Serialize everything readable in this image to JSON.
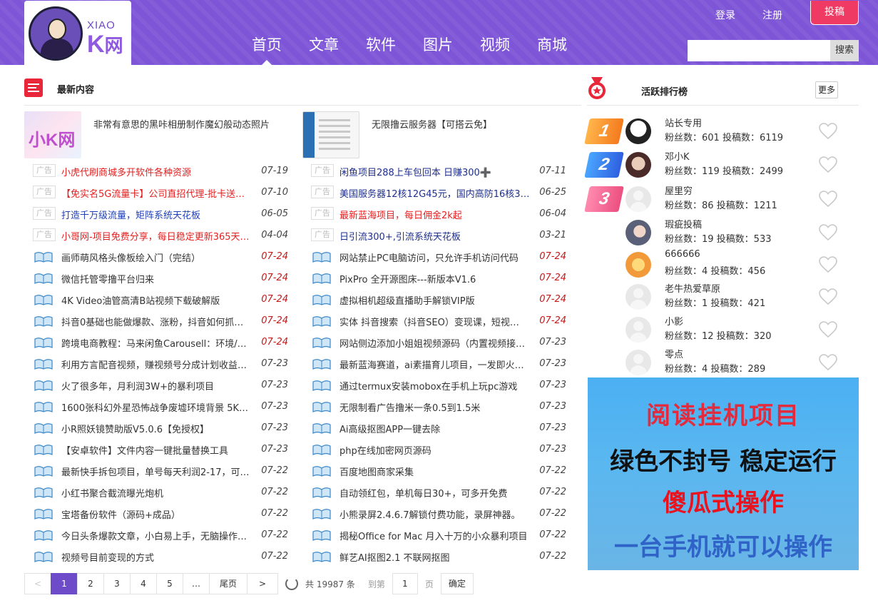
{
  "header": {
    "logo_small": "XIAO",
    "logo_big_k": "K",
    "logo_big_w": "网",
    "nav": [
      "首页",
      "文章",
      "软件",
      "图片",
      "视频",
      "商城"
    ],
    "login": "登录",
    "register": "注册",
    "post": "投稿",
    "search_value": "",
    "search_button": "搜索"
  },
  "latest": {
    "title": "最新内容",
    "features": [
      {
        "title": "非常有意思的黑咔相册制作魔幻般动态照片",
        "thumb_text": "小K网"
      },
      {
        "title": "无限撸云服务器【可搭云免】"
      }
    ],
    "ad_tag": "广告",
    "left": [
      {
        "title": "小虎代刷商城多开软件各种资源",
        "date": "07-19",
        "ad": true,
        "color": "red"
      },
      {
        "title": "【免实名5G流量卡】公司直招代理-批卡送…",
        "date": "07-10",
        "ad": true,
        "color": "red"
      },
      {
        "title": "打造千万级流量，矩阵系统天花板",
        "date": "06-05",
        "ad": true,
        "color": "blue"
      },
      {
        "title": "小哥网-项目免费分享，每日稳定更新365天…",
        "date": "04-04",
        "ad": true,
        "color": "red"
      },
      {
        "title": "画师萌风格头像板绘入门（完结）",
        "date": "07-24",
        "red": true
      },
      {
        "title": "微信托管零撸平台归来",
        "date": "07-24",
        "red": true
      },
      {
        "title": "4K Video油管高清B站视频下载破解版",
        "date": "07-24",
        "red": true
      },
      {
        "title": "抖音0基础也能做爆款、涨粉，抖音如何抓…",
        "date": "07-24",
        "red": true
      },
      {
        "title": "跨境电商教程：马来闲鱼Carousell：环境/…",
        "date": "07-24",
        "red": true
      },
      {
        "title": "利用方言配音视频，赚视频号分成计划收益…",
        "date": "07-23"
      },
      {
        "title": "火了很多年，月利润3W+的暴利项目",
        "date": "07-23"
      },
      {
        "title": "1600张科幻外星恐怖战争废墟环境背景 5K…",
        "date": "07-23"
      },
      {
        "title": "小R照妖镜赞助版V5.0.6【免授权】",
        "date": "07-23"
      },
      {
        "title": "【安卓软件】文件内容一键批量替换工具",
        "date": "07-23"
      },
      {
        "title": "最新快手拆包项目，单号每天利润2-17，可…",
        "date": "07-22"
      },
      {
        "title": "小红书聚合截流曝光炮机",
        "date": "07-22"
      },
      {
        "title": "宝塔备份软件（源码+成品）",
        "date": "07-22"
      },
      {
        "title": "今日头条爆款文章，小白易上手，无脑操作…",
        "date": "07-22"
      },
      {
        "title": "视频号目前变现的方式",
        "date": "07-22"
      }
    ],
    "right": [
      {
        "title": "闲鱼项目288上车包回本 日赚300➕",
        "date": "07-11",
        "ad": true,
        "color": "dblue"
      },
      {
        "title": "美国服务器12核12G45元，国内高防16核3…",
        "date": "06-25",
        "ad": true,
        "color": "dblue"
      },
      {
        "title": "最新蓝海项目，每日佣金2k起",
        "date": "06-04",
        "ad": true,
        "color": "red"
      },
      {
        "title": "日引流300+,引流系统天花板",
        "date": "03-21",
        "ad": true,
        "color": "dblue"
      },
      {
        "title": "网站禁止PC电脑访问，只允许手机访问代码",
        "date": "07-24",
        "red": true
      },
      {
        "title": "PixPro 全开源图床---新版本V1.6",
        "date": "07-24",
        "red": true
      },
      {
        "title": "虚拟相机超级直播助手解锁VIP版",
        "date": "07-24",
        "red": true
      },
      {
        "title": "实体 抖音搜索（抖音SEO）变现课，短视…",
        "date": "07-24",
        "red": true
      },
      {
        "title": "网站侧边添加小姐姐视频源码（内置视频接…",
        "date": "07-23"
      },
      {
        "title": "最新蓝海赛道，ai素描育儿项目，一发即火…",
        "date": "07-23"
      },
      {
        "title": "通过termux安装mobox在手机上玩pc游戏",
        "date": "07-23"
      },
      {
        "title": "无限制看广告撸米一条0.5到1.5米",
        "date": "07-23"
      },
      {
        "title": "Ai高级抠图APP一键去除",
        "date": "07-23"
      },
      {
        "title": "php在线加密网页源码",
        "date": "07-23"
      },
      {
        "title": "百度地图商家采集",
        "date": "07-22"
      },
      {
        "title": "自动领红包，单机每日30+，可多开免费",
        "date": "07-22"
      },
      {
        "title": "小熊录屏2.4.6.7解锁付费功能，录屏神器。",
        "date": "07-22"
      },
      {
        "title": "揭秘Office for Mac 月入十万的小众暴利项目",
        "date": "07-22"
      },
      {
        "title": "鲜艺AI抠图2.1 不联网抠图",
        "date": "07-22"
      }
    ]
  },
  "pager": {
    "prev": "<",
    "pages": [
      "1",
      "2",
      "3",
      "4",
      "5",
      "…"
    ],
    "last": "尾页",
    "next": ">",
    "total": "共 19987 条",
    "goto_label": "到第",
    "goto_value": "1",
    "page_unit": "页",
    "confirm": "确定"
  },
  "ranking": {
    "title": "活跃排行榜",
    "more": "更多",
    "users": [
      {
        "rank": "1",
        "name": "站长专用",
        "stats": "粉丝数：601 投稿数：6119"
      },
      {
        "rank": "2",
        "name": "邓小K",
        "stats": "粉丝数：119 投稿数：2499"
      },
      {
        "rank": "3",
        "name": "屋里穷",
        "stats": "粉丝数：86 投稿数：1211"
      },
      {
        "rank": "",
        "name": "瑕疵投稿",
        "stats": "粉丝数：19 投稿数：533"
      },
      {
        "rank": "",
        "name": "666666",
        "stats": "粉丝数：4 投稿数：456"
      },
      {
        "rank": "",
        "name": "老牛热爱草原",
        "stats": "粉丝数：1 投稿数：421"
      },
      {
        "rank": "",
        "name": "小影",
        "stats": "粉丝数：12 投稿数：320"
      },
      {
        "rank": "",
        "name": "零点",
        "stats": "粉丝数：4 投稿数：289"
      }
    ]
  },
  "ad_banner": {
    "line1": "阅读挂机项目",
    "line2": "绿色不封号 稳定运行",
    "line3": "傻瓜式操作",
    "line4": "一台手机就可以操作"
  },
  "colors": {
    "header": "#7d55d6",
    "accent": "#ef3a63",
    "active_page": "#6e4bc9"
  }
}
